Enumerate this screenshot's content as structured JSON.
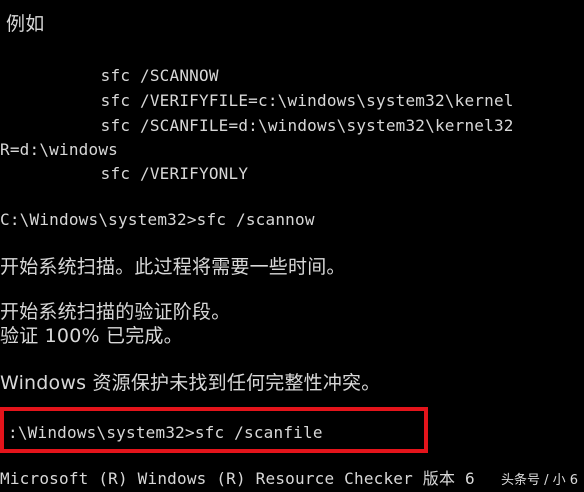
{
  "console": {
    "background": "#000000",
    "text_color": "#d8d8d8",
    "highlight_color": "#e4141b",
    "lines": [
      "例如",
      "        sfc /SCANNOW",
      "        sfc /VERIFYFILE=c:\\windows\\system32\\kernel",
      "        sfc /SCANFILE=d:\\windows\\system32\\kernel32",
      "R=d:\\windows",
      "        sfc /VERIFYONLY",
      "C:\\Windows\\system32>sfc /scannow",
      "开始系统扫描。此过程将需要一些时间。",
      "开始系统扫描的验证阶段。",
      "验证 100% 已完成。",
      "Windows 资源保护未找到任何完整性冲突。",
      ":\\Windows\\system32>sfc /scanfile",
      "Microsoft (R) Windows (R) Resource Checker 版本 6"
    ]
  },
  "watermark": "头条号 / 小 6"
}
